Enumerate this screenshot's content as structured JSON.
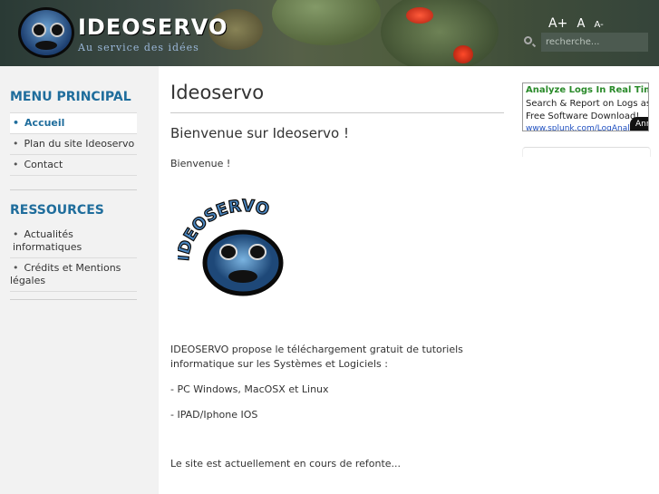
{
  "header": {
    "brand": "IDEOSERVO",
    "tagline": "Au service des idées",
    "font_size_controls": [
      "A+",
      "A",
      "A-"
    ],
    "search": {
      "placeholder": "recherche..."
    }
  },
  "sidebar": {
    "main_menu": {
      "title": "MENU PRINCIPAL",
      "items": [
        "Accueil",
        "Plan du site Ideoservo",
        "Contact"
      ]
    },
    "resources": {
      "title": "RESSOURCES",
      "items": [
        "Actualités informatiques",
        "Crédits et Mentions légales"
      ]
    }
  },
  "main": {
    "page_title": "Ideoservo",
    "subtitle": "Bienvenue sur Ideoservo !",
    "greeting": "Bienvenue !",
    "logo_text": "IDEOSERVO",
    "intro": "IDEOSERVO propose le téléchargement gratuit de tutoriels informatique sur les Systèmes et Logiciels :",
    "list": [
      "- PC Windows, MacOSX et Linux",
      "- IPAD/Iphone IOS"
    ],
    "status": "Le site est actuellement en cours de refonte..."
  },
  "ad": {
    "title": "Analyze Logs In Real Time",
    "line1": "Search & Report on Logs as th",
    "line2": "Free Software Download!",
    "url": "www.splunk.com/LogAnaly",
    "button": "Ann"
  },
  "colors": {
    "accent": "#1f6d9c",
    "ad_title": "#2a8a2a"
  }
}
